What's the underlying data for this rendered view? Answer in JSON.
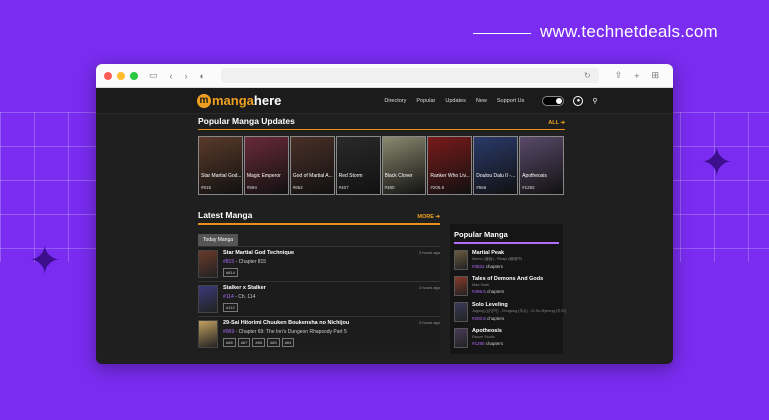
{
  "brand": {
    "text": "www.technetdeals.com"
  },
  "browser": {
    "dot_colors": [
      "#ff5f57",
      "#febc2e",
      "#28c840"
    ]
  },
  "site": {
    "logo_text_a": "manga",
    "logo_text_b": "here",
    "nav": [
      "Directory",
      "Popular",
      "Updates",
      "New",
      "Support Us"
    ]
  },
  "popular_updates": {
    "title": "Popular Manga Updates",
    "all_label": "ALL ➔",
    "items": [
      {
        "title": "Star Martial God...",
        "rank": "#815",
        "color": "#5a3a2a"
      },
      {
        "title": "Magic Emperor",
        "rank": "#594",
        "color": "#6a2a3a"
      },
      {
        "title": "God of Martial A...",
        "rank": "#652",
        "color": "#4a3028"
      },
      {
        "title": "Red Storm",
        "rank": "#407",
        "color": "#2a2a2a"
      },
      {
        "title": "Black Clover",
        "rank": "#380",
        "color": "#8a8a70"
      },
      {
        "title": "Ranker Who Liv...",
        "rank": "#205.9",
        "color": "#7a1a1a"
      },
      {
        "title": "Doulou Dalu II -...",
        "rank": "#566",
        "color": "#2a3a6a"
      },
      {
        "title": "Apotheosis",
        "rank": "#1292",
        "color": "#5a4a6a"
      }
    ]
  },
  "latest": {
    "title": "Latest Manga",
    "more_label": "MORE ➔",
    "tab_label": "Today Manga",
    "rows": [
      {
        "title": "Star Martial God Technique",
        "num": "#815",
        "chapter": " - Chapter 815",
        "time": "2 hours ago",
        "tags": [
          "#814"
        ],
        "color": "#6a3a2a"
      },
      {
        "title": "Stalker x Stalker",
        "num": "#114",
        "chapter": " - Ch. 114",
        "time": "2 hours ago",
        "tags": [
          "#113"
        ],
        "color": "#3a3a7a"
      },
      {
        "title": "29-Sai Hitorimi Chuuken Boukensha no Nichijou",
        "num": "#069",
        "chapter": " - Chapter 69: The Inn's Dungeon Rhapsody Part 5",
        "time": "2 hours ago",
        "tags": [
          "#68",
          "#67",
          "#66",
          "#65",
          "#64"
        ],
        "color": "#c0a060"
      }
    ]
  },
  "popular_manga": {
    "title": "Popular Manga",
    "items": [
      {
        "title": "Martial Peak",
        "genres": "Momo (漫画) , Pikapi (暗暗中)",
        "num": "#3831",
        "suffix": " chapters",
        "color": "#6a5a40"
      },
      {
        "title": "Tales of Demons And Gods",
        "genres": "Mad Snail",
        "num": "#496.5",
        "suffix": " chapters",
        "color": "#8a3a2a"
      },
      {
        "title": "Solo Leveling",
        "genres": "Jugong (장성락) , Chugong (추공) , Gi So-Ryeong (기소령)",
        "num": "#200.5",
        "suffix": " chapters",
        "color": "#3a3a5a"
      },
      {
        "title": "Apotheosis",
        "genres": "Ranze Studio",
        "num": "#1290",
        "suffix": " chapters",
        "color": "#4a3a5a"
      }
    ]
  }
}
